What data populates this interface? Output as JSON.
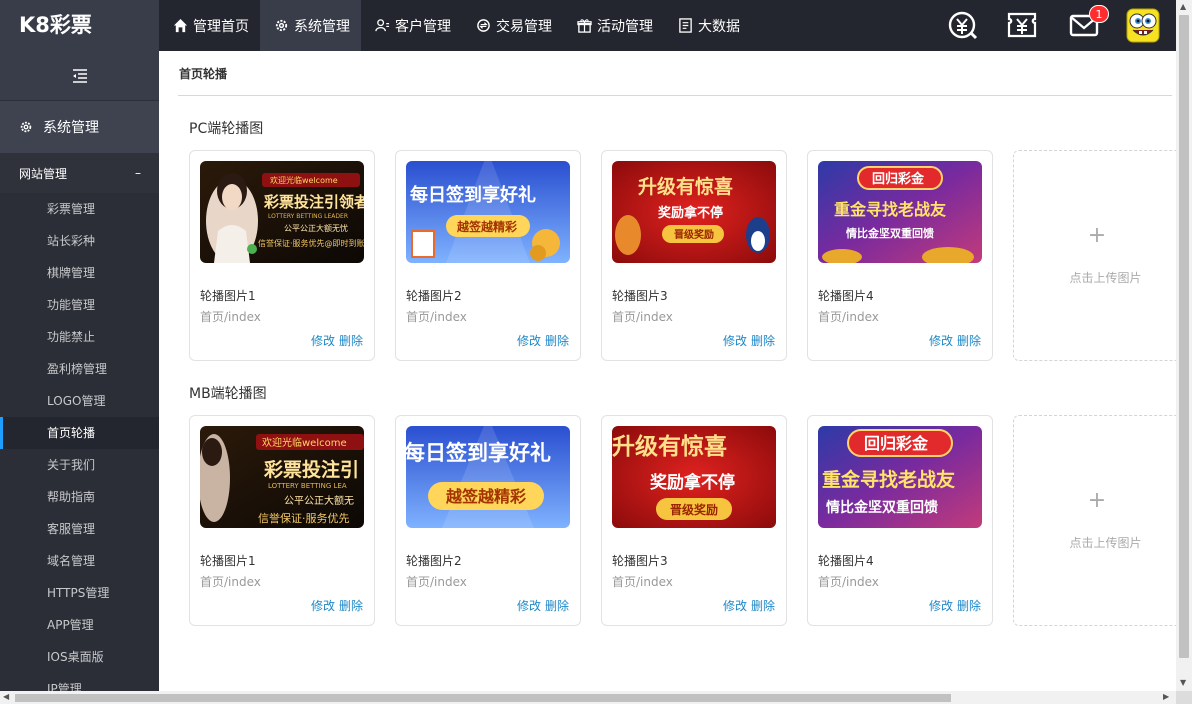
{
  "app": {
    "logo": "K8彩票"
  },
  "nav": [
    {
      "label": "管理首页",
      "icon": "home-icon",
      "active": false
    },
    {
      "label": "系统管理",
      "icon": "gear-icon",
      "active": true
    },
    {
      "label": "客户管理",
      "icon": "user-icon",
      "active": false
    },
    {
      "label": "交易管理",
      "icon": "exchange-icon",
      "active": false
    },
    {
      "label": "活动管理",
      "icon": "gift-icon",
      "active": false
    },
    {
      "label": "大数据",
      "icon": "report-icon",
      "active": false
    }
  ],
  "top_right": {
    "message_badge": "1"
  },
  "sidebar": {
    "system_label": "系统管理",
    "site_label": "网站管理",
    "site_toggle": "–",
    "items": [
      {
        "label": "彩票管理"
      },
      {
        "label": "站长彩种"
      },
      {
        "label": "棋牌管理"
      },
      {
        "label": "功能管理"
      },
      {
        "label": "功能禁止"
      },
      {
        "label": "盈利榜管理"
      },
      {
        "label": "LOGO管理"
      },
      {
        "label": "首页轮播"
      },
      {
        "label": "关于我们"
      },
      {
        "label": "帮助指南"
      },
      {
        "label": "客服管理"
      },
      {
        "label": "域名管理"
      },
      {
        "label": "HTTPS管理"
      },
      {
        "label": "APP管理"
      },
      {
        "label": "IOS桌面版"
      },
      {
        "label": "IP管理"
      }
    ],
    "active_index": 7
  },
  "main": {
    "title": "首页轮播",
    "sections": [
      {
        "title": "PC端轮播图",
        "cards": [
          {
            "name": "轮播图片1",
            "path": "首页/index",
            "edit": "修改",
            "delete": "删除",
            "banner": {
              "line1": "欢迎光临welcome",
              "line2": "彩票投注引领者",
              "line3": "LOTTERY BETTING LEADER",
              "line4": "公平公正大额无忧",
              "line5": "信誉保证·服务优先@即时到账"
            }
          },
          {
            "name": "轮播图片2",
            "path": "首页/index",
            "edit": "修改",
            "delete": "删除",
            "banner": {
              "line1": "每日签到享好礼",
              "line2": "越签越精彩"
            }
          },
          {
            "name": "轮播图片3",
            "path": "首页/index",
            "edit": "修改",
            "delete": "删除",
            "banner": {
              "line1": "升级有惊喜",
              "line2": "奖励拿不停",
              "line3": "晋级奖励"
            }
          },
          {
            "name": "轮播图片4",
            "path": "首页/index",
            "edit": "修改",
            "delete": "删除",
            "banner": {
              "line1": "回归彩金",
              "line2": "重金寻找老战友",
              "line3": "情比金坚双重回馈"
            }
          }
        ],
        "upload_label": "点击上传图片"
      },
      {
        "title": "MB端轮播图",
        "cards": [
          {
            "name": "轮播图片1",
            "path": "首页/index",
            "edit": "修改",
            "delete": "删除",
            "banner": {
              "line1": "欢迎光临welcome",
              "line2": "彩票投注引",
              "line3": "LOTTERY BETTING LEA",
              "line4": "公平公正大额无",
              "line5": "信誉保证·服务优先"
            }
          },
          {
            "name": "轮播图片2",
            "path": "首页/index",
            "edit": "修改",
            "delete": "删除",
            "banner": {
              "line1": "每日签到享好礼",
              "line2": "越签越精彩"
            }
          },
          {
            "name": "轮播图片3",
            "path": "首页/index",
            "edit": "修改",
            "delete": "删除",
            "banner": {
              "line1": "升级有惊喜",
              "line2": "奖励拿不停",
              "line3": "晋级奖励"
            }
          },
          {
            "name": "轮播图片4",
            "path": "首页/index",
            "edit": "修改",
            "delete": "删除",
            "banner": {
              "line1": "回归彩金",
              "line2": "重金寻找老战友",
              "line3": "情比金坚双重回馈"
            }
          }
        ],
        "upload_label": "点击上传图片"
      }
    ]
  }
}
